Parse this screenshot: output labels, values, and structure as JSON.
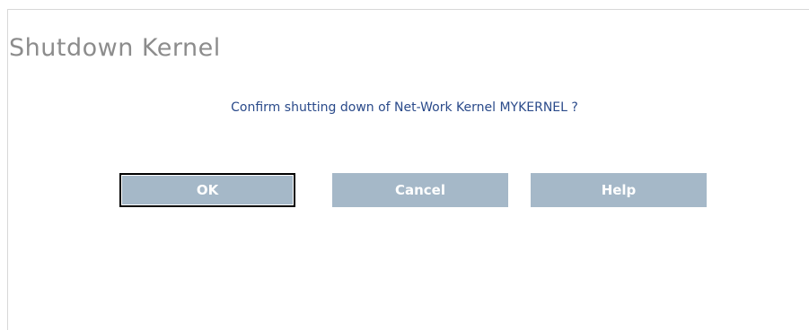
{
  "dialog": {
    "title": "Shutdown Kernel",
    "message": "Confirm shutting down of Net-Work Kernel MYKERNEL ?"
  },
  "buttons": {
    "ok_label": "OK",
    "cancel_label": "Cancel",
    "help_label": "Help"
  },
  "colors": {
    "title_text": "#8c8c8c",
    "message_text": "#2a4a8a",
    "button_background": "#a5b8c8",
    "button_text": "#ffffff",
    "focus_border": "#000000"
  }
}
